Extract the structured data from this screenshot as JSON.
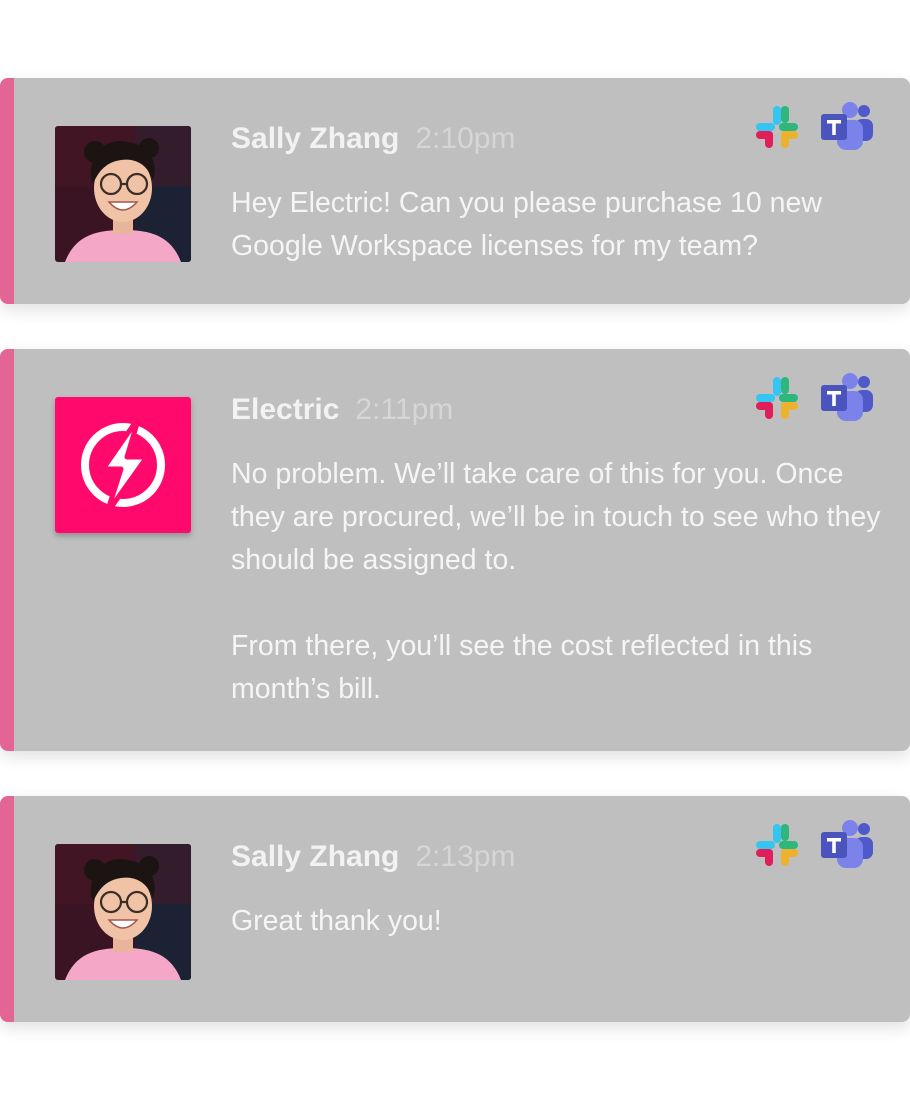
{
  "messages": [
    {
      "sender": "Sally Zhang",
      "time": "2:10pm",
      "paragraphs": [
        "Hey Electric! Can you please purchase 10 new Google Workspace licenses for my team?"
      ],
      "avatar": "sally-zhang-photo",
      "integrations": [
        "slack-icon",
        "microsoft-teams-icon"
      ]
    },
    {
      "sender": "Electric",
      "time": "2:11pm",
      "paragraphs": [
        "No problem. We’ll take care of this for you. Once they are procured, we’ll be in touch to see who they should be assigned to.",
        "From there, you’ll see the cost reflected in this month’s bill."
      ],
      "avatar": "electric-logo",
      "integrations": [
        "slack-icon",
        "microsoft-teams-icon"
      ]
    },
    {
      "sender": "Sally Zhang",
      "time": "2:13pm",
      "paragraphs": [
        "Great thank you!"
      ],
      "avatar": "sally-zhang-photo",
      "integrations": [
        "slack-icon",
        "microsoft-teams-icon"
      ]
    }
  ],
  "colors": {
    "card_background": "#bfbfbf",
    "accent_bar": "#e26596",
    "electric_brand": "#ff0a6c",
    "teams_purple": "#4b53bc"
  }
}
